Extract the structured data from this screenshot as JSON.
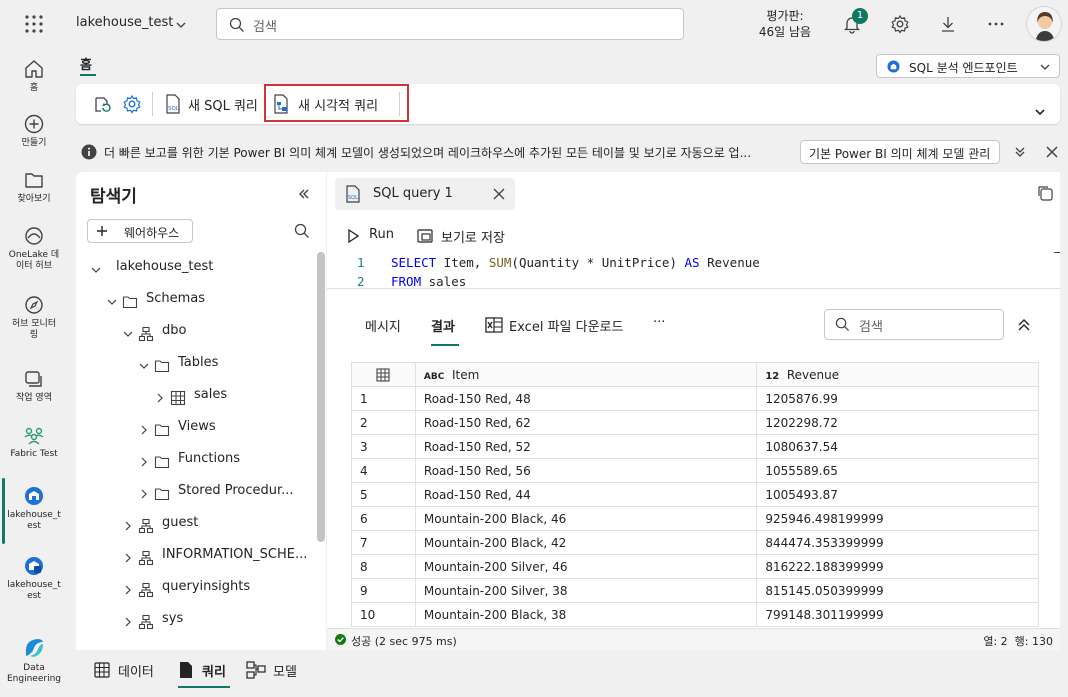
{
  "topbar": {
    "workspace": "lakehouse_test",
    "search_placeholder": "검색",
    "trial_line1": "평가판:",
    "trial_line2": "46일 남음",
    "notification_count": "1"
  },
  "rail": [
    {
      "label": "홈",
      "icon": "home-icon"
    },
    {
      "label": "만들기",
      "icon": "plus-circle-icon"
    },
    {
      "label": "찾아보기",
      "icon": "folder-icon"
    },
    {
      "label1": "OneLake 데",
      "label2": "이터 허브",
      "icon": "onelake-icon"
    },
    {
      "label1": "허브 모니터",
      "label2": "링",
      "icon": "monitor-icon"
    },
    {
      "label": "작업 영역",
      "icon": "workspaces-icon"
    },
    {
      "label": "Fabric Test",
      "icon": "people-icon"
    },
    {
      "label1": "lakehouse_t",
      "label2": "est",
      "icon": "lakehouse-icon"
    },
    {
      "label1": "lakehouse_t",
      "label2": "est",
      "icon": "sql-endpoint-icon"
    },
    {
      "label1": "Data",
      "label2": "Engineering",
      "icon": "data-engineering-icon"
    }
  ],
  "home_tab": "홈",
  "endpoint_label": "SQL 분석 엔드포인트",
  "ribbon": {
    "new_sql_query": "새 SQL 쿼리",
    "new_visual_query": "새 시각적 쿼리"
  },
  "banner": {
    "message": "더 빠른 보고를 위한 기본 Power BI 의미 체계 모델이 생성되었으며 레이크하우스에 추가된 모든 테이블 및 보기로 자동으로 업...",
    "manage_button": "기본 Power BI 의미 체계 모델 관리"
  },
  "explorer": {
    "title": "탐색기",
    "add_warehouse": "웨어하우스",
    "tree": [
      {
        "label": "lakehouse_test",
        "depth": 0,
        "icon": "none",
        "expanded": true
      },
      {
        "label": "Schemas",
        "depth": 1,
        "icon": "folder",
        "expanded": true
      },
      {
        "label": "dbo",
        "depth": 2,
        "icon": "schema",
        "expanded": true
      },
      {
        "label": "Tables",
        "depth": 3,
        "icon": "folder",
        "expanded": true
      },
      {
        "label": "sales",
        "depth": 4,
        "icon": "table",
        "expanded": false
      },
      {
        "label": "Views",
        "depth": 3,
        "icon": "folder",
        "expanded": false
      },
      {
        "label": "Functions",
        "depth": 3,
        "icon": "folder",
        "expanded": false
      },
      {
        "label": "Stored Procedur...",
        "depth": 3,
        "icon": "folder",
        "expanded": false
      },
      {
        "label": "guest",
        "depth": 2,
        "icon": "schema",
        "expanded": false
      },
      {
        "label": "INFORMATION_SCHE...",
        "depth": 2,
        "icon": "schema",
        "expanded": false
      },
      {
        "label": "queryinsights",
        "depth": 2,
        "icon": "schema",
        "expanded": false
      },
      {
        "label": "sys",
        "depth": 2,
        "icon": "schema",
        "expanded": false
      }
    ]
  },
  "editor": {
    "tab_title": "SQL query 1",
    "run_label": "Run",
    "save_as_view": "보기로 저장",
    "code_lines": [
      {
        "num": "1",
        "kw1": "SELECT",
        "t1": " Item, ",
        "fn": "SUM",
        "t2": "(Quantity * UnitPrice) ",
        "kw2": "AS",
        "t3": " Revenue"
      },
      {
        "num": "2",
        "kw1": "FROM",
        "t1": " sales",
        "fn": "",
        "t2": "",
        "kw2": "",
        "t3": ""
      }
    ],
    "results_tabs": {
      "messages": "메시지",
      "results": "결과",
      "excel": "Excel 파일 다운로드",
      "more": "···"
    },
    "results_search_placeholder": "검색",
    "columns": [
      {
        "type": "ABC",
        "name": "Item"
      },
      {
        "type": "12",
        "name": "Revenue"
      }
    ],
    "rows": [
      [
        "1",
        "Road-150 Red, 48",
        "1205876.99"
      ],
      [
        "2",
        "Road-150 Red, 62",
        "1202298.72"
      ],
      [
        "3",
        "Road-150 Red, 52",
        "1080637.54"
      ],
      [
        "4",
        "Road-150 Red, 56",
        "1055589.65"
      ],
      [
        "5",
        "Road-150 Red, 44",
        "1005493.87"
      ],
      [
        "6",
        "Mountain-200 Black, 46",
        "925946.498199999"
      ],
      [
        "7",
        "Mountain-200 Black, 42",
        "844474.353399999"
      ],
      [
        "8",
        "Mountain-200 Silver, 46",
        "816222.188399999"
      ],
      [
        "9",
        "Mountain-200 Silver, 38",
        "815145.050399999"
      ],
      [
        "10",
        "Mountain-200 Black, 38",
        "799148.301199999"
      ]
    ],
    "status_success": "성공 (2 sec 975 ms)",
    "status_right": "열: 2  행: 130"
  },
  "bottom_tabs": [
    "데이터",
    "쿼리",
    "모델"
  ],
  "colors": {
    "accent": "#117865",
    "highlight": "#d13438",
    "keyword": "#0000ff",
    "function": "#795e26"
  }
}
